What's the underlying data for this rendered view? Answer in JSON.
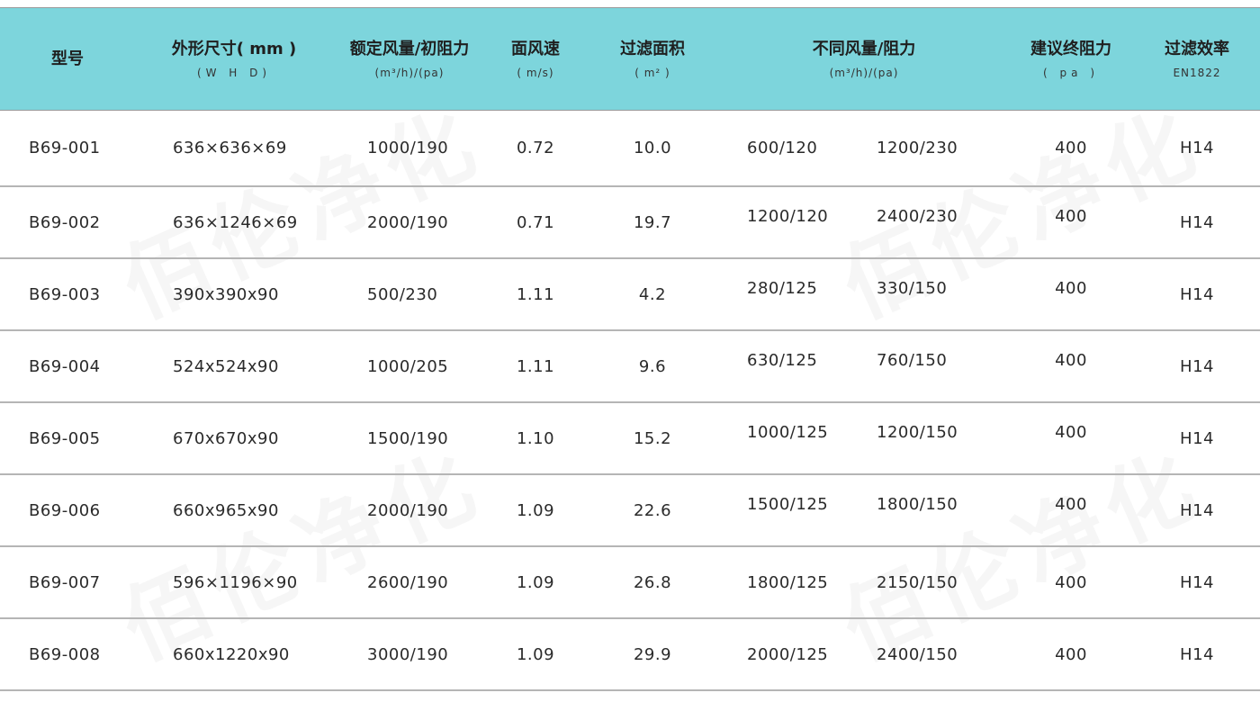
{
  "watermark": "佰伦净化",
  "headers": {
    "model": {
      "main": "型号"
    },
    "size": {
      "main": "外形尺寸( mm )",
      "sub": "(W H D)"
    },
    "rated": {
      "main": "额定风量/初阻力",
      "sub": "(m³/h)/(pa)"
    },
    "velocity": {
      "main": "面风速",
      "sub": "( m/s)"
    },
    "area": {
      "main": "过滤面积",
      "sub": "( m² )"
    },
    "flow": {
      "main": "不同风量/阻力",
      "sub": "(m³/h)/(pa)"
    },
    "final": {
      "main": "建议终阻力",
      "sub": "( pa )"
    },
    "efficiency": {
      "main": "过滤效率",
      "sub": "EN1822"
    }
  },
  "rows": [
    {
      "model": "B69-001",
      "size": "636×636×69",
      "rated": "1000/190",
      "velocity": "0.72",
      "area": "10.0",
      "flow_a": "600/120",
      "flow_b": "1200/230",
      "final": "400",
      "efficiency": "H14"
    },
    {
      "model": "B69-002",
      "size": "636×1246×69",
      "rated": "2000/190",
      "velocity": "0.71",
      "area": "19.7",
      "flow_a": "1200/120",
      "flow_b": "2400/230",
      "final": "400",
      "efficiency": "H14"
    },
    {
      "model": "B69-003",
      "size": "390x390x90",
      "rated": "500/230",
      "velocity": "1.11",
      "area": "4.2",
      "flow_a": "280/125",
      "flow_b": "330/150",
      "final": "400",
      "efficiency": "H14"
    },
    {
      "model": "B69-004",
      "size": "524x524x90",
      "rated": "1000/205",
      "velocity": "1.11",
      "area": "9.6",
      "flow_a": "630/125",
      "flow_b": "760/150",
      "final": "400",
      "efficiency": "H14"
    },
    {
      "model": "B69-005",
      "size": "670x670x90",
      "rated": "1500/190",
      "velocity": "1.10",
      "area": "15.2",
      "flow_a": "1000/125",
      "flow_b": "1200/150",
      "final": "400",
      "efficiency": "H14"
    },
    {
      "model": "B69-006",
      "size": "660x965x90",
      "rated": "2000/190",
      "velocity": "1.09",
      "area": "22.6",
      "flow_a": "1500/125",
      "flow_b": "1800/150",
      "final": "400",
      "efficiency": "H14"
    },
    {
      "model": "B69-007",
      "size": "596×1196×90",
      "rated": "2600/190",
      "velocity": "1.09",
      "area": "26.8",
      "flow_a": "1800/125",
      "flow_b": "2150/150",
      "final": "400",
      "efficiency": "H14"
    },
    {
      "model": "B69-008",
      "size": "660x1220x90",
      "rated": "3000/190",
      "velocity": "1.09",
      "area": "29.9",
      "flow_a": "2000/125",
      "flow_b": "2400/150",
      "final": "400",
      "efficiency": "H14"
    }
  ]
}
